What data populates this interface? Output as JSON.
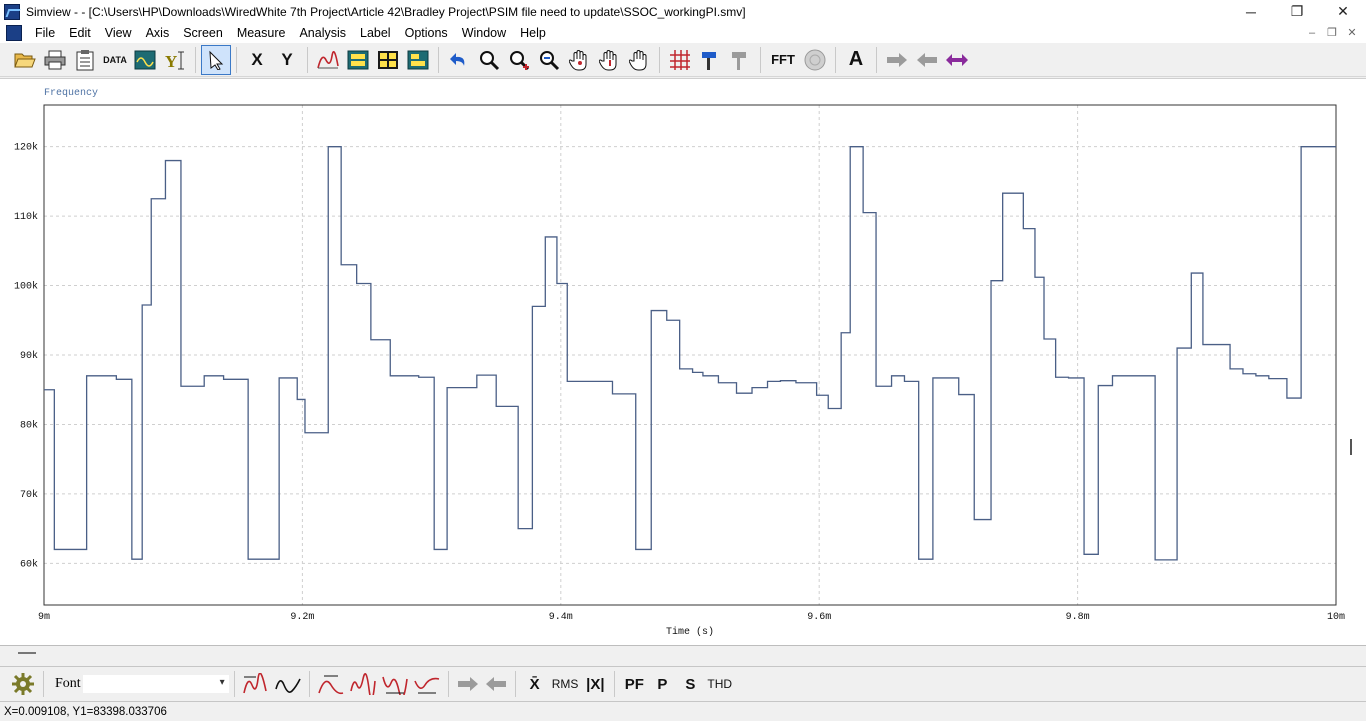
{
  "window": {
    "title": "Simview -  - [C:\\Users\\HP\\Downloads\\WiredWhite 7th Project\\Article 42\\Bradley Project\\PSIM file need to update\\SSOC_workingPI.smv]",
    "min": "─",
    "max": "❐",
    "close": "✕"
  },
  "menu": [
    "File",
    "Edit",
    "View",
    "Axis",
    "Screen",
    "Measure",
    "Analysis",
    "Label",
    "Options",
    "Window",
    "Help"
  ],
  "mdi": {
    "min": "–",
    "restore": "❐",
    "close": "✕"
  },
  "toolbar": {
    "data_label": "DATA",
    "x_label": "X",
    "y_label": "Y",
    "fft_label": "FFT",
    "text_label": "A"
  },
  "bottom_toolbar": {
    "font_label": "Font",
    "font_value": "",
    "rms_label": "RMS",
    "pf_label": "PF",
    "p_label": "P",
    "s_label": "S",
    "thd_label": "THD",
    "mean_label": "X̄",
    "absmean_label": "|X|"
  },
  "status": {
    "text": "X=0.009108, Y1=83398.033706"
  },
  "colors": {
    "trace": "#4a5f86",
    "grid": "#cfcfcf",
    "legend": "#4f73a4"
  },
  "chart_data": {
    "type": "line",
    "step": true,
    "series": [
      {
        "name": "Frequency",
        "x": [
          0.009,
          0.009008,
          0.009033,
          0.009056,
          0.009068,
          0.009076,
          0.009083,
          0.009094,
          0.009106,
          0.009124,
          0.009139,
          0.009158,
          0.009182,
          0.009196,
          0.009202,
          0.00922,
          0.00923,
          0.009242,
          0.009253,
          0.009268,
          0.00929,
          0.009302,
          0.009312,
          0.009335,
          0.00935,
          0.009367,
          0.009378,
          0.009388,
          0.009397,
          0.009405,
          0.00944,
          0.009458,
          0.00947,
          0.009482,
          0.009492,
          0.009502,
          0.00951,
          0.009522,
          0.009536,
          0.009548,
          0.00956,
          0.00957,
          0.009582,
          0.009598,
          0.009607,
          0.009617,
          0.009624,
          0.009634,
          0.009644,
          0.009656,
          0.009666,
          0.009677,
          0.009688,
          0.009708,
          0.00972,
          0.009733,
          0.009742,
          0.009758,
          0.009767,
          0.009774,
          0.009783,
          0.009793,
          0.009805,
          0.009816,
          0.009827,
          0.00986,
          0.009877,
          0.009888,
          0.009897,
          0.009918,
          0.009928,
          0.009938,
          0.009948,
          0.009962,
          0.009973,
          0.00998,
          0.009989,
          0.009995
        ],
        "y": [
          85000,
          62000,
          87000,
          86500,
          60600,
          97200,
          112500,
          118000,
          85500,
          87000,
          86500,
          60600,
          86700,
          83600,
          78800,
          120000,
          103000,
          100300,
          92200,
          87000,
          86800,
          62000,
          85300,
          87100,
          82600,
          65000,
          97000,
          107000,
          100300,
          86200,
          84400,
          62000,
          96400,
          95000,
          88000,
          87500,
          87000,
          86000,
          84500,
          85300,
          86200,
          86300,
          86000,
          84200,
          82300,
          93200,
          120000,
          110500,
          85500,
          87000,
          86200,
          60600,
          86700,
          84300,
          66300,
          100700,
          113300,
          108200,
          101200,
          92300,
          86800,
          86700,
          61300,
          85600,
          87000,
          60500,
          91000,
          101800,
          91500,
          88000,
          87300,
          87000,
          86600,
          83800,
          120000,
          120000,
          120000,
          120000
        ]
      }
    ],
    "xlabel": "Time (s)",
    "ylabel": "",
    "xlim": [
      0.009,
      0.01
    ],
    "ylim": [
      54000,
      126000
    ],
    "xticks": [
      0.009,
      0.0092,
      0.0094,
      0.0096,
      0.0098,
      0.01
    ],
    "xtick_labels": [
      "9m",
      "9.2m",
      "9.4m",
      "9.6m",
      "9.8m",
      "10m"
    ],
    "yticks": [
      60000,
      70000,
      80000,
      90000,
      100000,
      110000,
      120000
    ],
    "ytick_labels": [
      "60k",
      "70k",
      "80k",
      "90k",
      "100k",
      "110k",
      "120k"
    ],
    "grid": true,
    "legend": "top-left"
  }
}
